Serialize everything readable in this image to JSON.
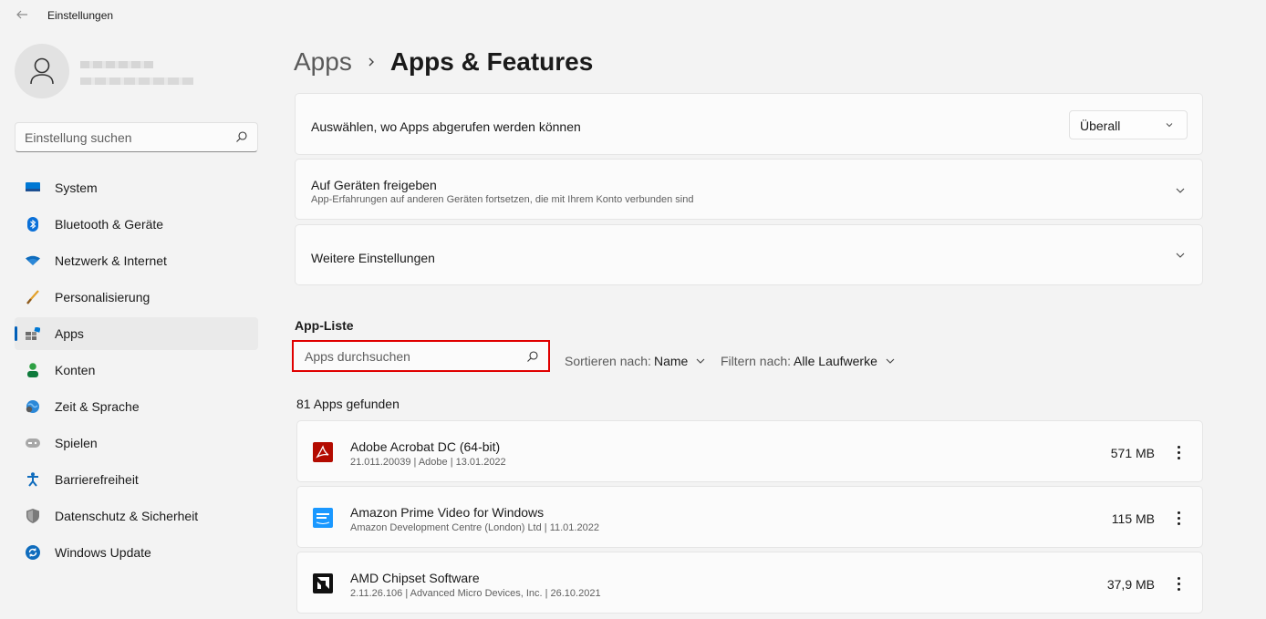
{
  "window": {
    "title": "Einstellungen"
  },
  "sidebar": {
    "search_placeholder": "Einstellung suchen",
    "items": [
      {
        "label": "System",
        "icon": "monitor-icon"
      },
      {
        "label": "Bluetooth & Geräte",
        "icon": "bluetooth-icon"
      },
      {
        "label": "Netzwerk & Internet",
        "icon": "wifi-icon"
      },
      {
        "label": "Personalisierung",
        "icon": "brush-icon"
      },
      {
        "label": "Apps",
        "icon": "apps-icon",
        "active": true
      },
      {
        "label": "Konten",
        "icon": "person-icon"
      },
      {
        "label": "Zeit & Sprache",
        "icon": "globe-clock-icon"
      },
      {
        "label": "Spielen",
        "icon": "gamepad-icon"
      },
      {
        "label": "Barrierefreiheit",
        "icon": "accessibility-icon"
      },
      {
        "label": "Datenschutz & Sicherheit",
        "icon": "shield-icon"
      },
      {
        "label": "Windows Update",
        "icon": "update-icon"
      }
    ]
  },
  "breadcrumb": {
    "parent": "Apps",
    "current": "Apps & Features"
  },
  "settings": {
    "source": {
      "label": "Auswählen, wo Apps abgerufen werden können",
      "value": "Überall"
    },
    "share": {
      "label": "Auf Geräten freigeben",
      "description": "App-Erfahrungen auf anderen Geräten fortsetzen, die mit Ihrem Konto verbunden sind"
    },
    "more": {
      "label": "Weitere Einstellungen"
    }
  },
  "app_list": {
    "title": "App-Liste",
    "search_placeholder": "Apps durchsuchen",
    "sort_label": "Sortieren nach:",
    "sort_value": "Name",
    "filter_label": "Filtern nach:",
    "filter_value": "Alle Laufwerke",
    "count": "81 Apps gefunden",
    "apps": [
      {
        "name": "Adobe Acrobat DC (64-bit)",
        "meta": "21.011.20039  |  Adobe  |  13.01.2022",
        "size": "571 MB",
        "icon": "adobe-acrobat-icon"
      },
      {
        "name": "Amazon Prime Video for Windows",
        "meta": "Amazon Development Centre (London) Ltd  |  11.01.2022",
        "size": "115 MB",
        "icon": "prime-video-icon"
      },
      {
        "name": "AMD Chipset Software",
        "meta": "2.11.26.106  |  Advanced Micro Devices, Inc.  |  26.10.2021",
        "size": "37,9 MB",
        "icon": "amd-icon"
      }
    ]
  },
  "colors": {
    "accent": "#005fb8",
    "highlight": "#e00000",
    "adobe": "#b30b00",
    "prime": "#1a98ff"
  }
}
